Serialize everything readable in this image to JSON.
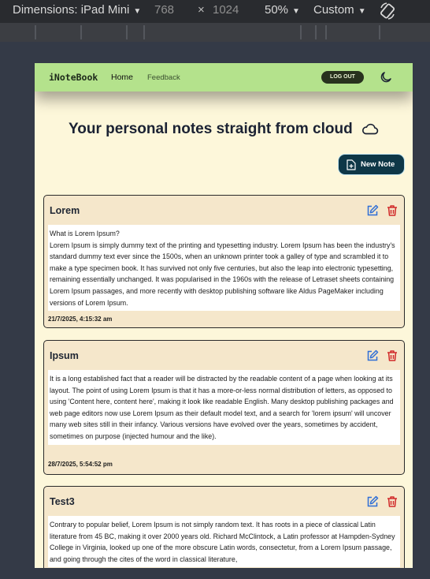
{
  "devtools": {
    "device": "Dimensions: iPad Mini",
    "width": "768",
    "x": "×",
    "height": "1024",
    "zoom": "50%",
    "throttle": "Custom"
  },
  "navbar": {
    "brand": "iNoteBook",
    "links": [
      "Home",
      "Feedback"
    ],
    "logout_label": "LOG OUT"
  },
  "page": {
    "title": "Your personal notes straight from cloud",
    "new_note_label": "New Note"
  },
  "notes": [
    {
      "title": "Lorem",
      "body": "What is Lorem Ipsum?\nLorem Ipsum is simply dummy text of the printing and typesetting industry. Lorem Ipsum has been the industry's standard dummy text ever since the 1500s, when an unknown printer took a galley of type and scrambled it to make a type specimen book. It has survived not only five centuries, but also the leap into electronic typesetting, remaining essentially unchanged. It was popularised in the 1960s with the release of Letraset sheets containing Lorem Ipsum passages, and more recently with desktop publishing software like Aldus PageMaker including versions of Lorem Ipsum.",
      "date": "21/7/2025, 4:15:32 am"
    },
    {
      "title": "Ipsum",
      "body": "It is a long established fact that a reader will be distracted by the readable content of a page when looking at its layout. The point of using Lorem Ipsum is that it has a more-or-less normal distribution of letters, as opposed to using 'Content here, content here', making it look like readable English. Many desktop publishing packages and web page editors now use Lorem Ipsum as their default model text, and a search for 'lorem ipsum' will uncover many web sites still in their infancy. Various versions have evolved over the years, sometimes by accident, sometimes on purpose (injected humour and the like).",
      "date": "28/7/2025, 5:54:52 pm"
    },
    {
      "title": "Test3",
      "body": "Contrary to popular belief, Lorem Ipsum is not simply random text. It has roots in a piece of classical Latin literature from 45 BC, making it over 2000 years old. Richard McClintock, a Latin professor at Hampden-Sydney College in Virginia, looked up one of the more obscure Latin words, consectetur, from a Lorem Ipsum passage, and going through the cites of the word in classical literature,",
      "date": ""
    }
  ],
  "colors": {
    "navbar": "#b4e28c",
    "page_bg": "#fdf7da",
    "card_bg": "#f5e7cb",
    "edit_icon": "#2f6fd6",
    "delete_icon": "#d12a2a",
    "new_note_bg": "#0e3747"
  },
  "icons": {
    "dropdown": "chevron-down-icon",
    "rotate": "rotate-icon",
    "theme": "moon-icon",
    "title": "cloud-icon",
    "new_note": "file-plus-icon",
    "edit": "edit-icon",
    "delete": "trash-icon"
  }
}
